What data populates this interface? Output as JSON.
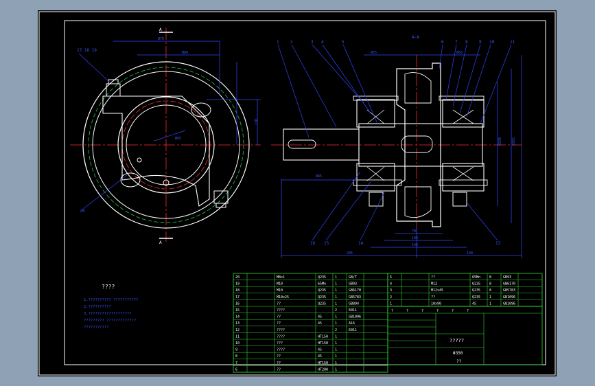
{
  "colors": {
    "outer": "#8fa2b5",
    "paper": "#000000",
    "border": "#ffffff",
    "outline": "#ffffff",
    "centerline": "#ff2a2a",
    "dimension": "#3344ff",
    "hidden": "#22cc44",
    "table": "#33dd33",
    "note_text": "#3355ff",
    "label": "#ffffff"
  },
  "section_mark": "A-A",
  "section_top_label": "A",
  "section_bottom_label": "A",
  "left_leader_labels": "17 18 19",
  "left_bottom_label": "20",
  "dims_left": {
    "top": "Ø70",
    "top2": "Ø84",
    "center": "Ø85",
    "right": "130",
    "far_right": "Ø90"
  },
  "dims_right": {
    "d1": "Ø45",
    "d2": "Ø55",
    "d3": "Ø60",
    "bottom1": "70",
    "bottom2": "100",
    "bottom3": "140",
    "bottom4": "170",
    "total_left": "205",
    "total_right": "190",
    "bore": "Ø280",
    "outer": "Ø355"
  },
  "balloons_top": [
    "1",
    "2",
    "3",
    "4",
    "5",
    "6",
    "7",
    "8",
    "9",
    "10",
    "11",
    "12"
  ],
  "balloons_bottom": [
    "16",
    "15",
    "14",
    "13"
  ],
  "notes": {
    "title": "????",
    "lines": [
      "1.??????????  ???????????",
      "2.??????????",
      "3.???????????????????",
      "  ????????? ?????????????",
      "  ???????????"
    ]
  },
  "parts_left": [
    {
      "no": "20",
      "code": "",
      "name": "M8x1",
      "qty": "1",
      "mat": "Q235",
      "spec": "GB/T"
    },
    {
      "no": "19",
      "code": "",
      "name": "M10",
      "qty": "1",
      "mat": "65Mn",
      "spec": "GB93"
    },
    {
      "no": "18",
      "code": "",
      "name": "M10",
      "qty": "1",
      "mat": "Q235",
      "spec": "GB6170"
    },
    {
      "no": "17",
      "code": "",
      "name": "M10x25",
      "qty": "1",
      "mat": "Q235",
      "spec": "GB5783"
    },
    {
      "no": "16",
      "code": "",
      "name": "??",
      "qty": "1",
      "mat": "Q235",
      "spec": "GB894"
    },
    {
      "no": "15",
      "code": "",
      "name": "????",
      "qty": "2",
      "mat": "",
      "spec": "6011"
    },
    {
      "no": "14",
      "code": "",
      "name": "??",
      "qty": "1",
      "mat": "45",
      "spec": "GB1096"
    },
    {
      "no": "13",
      "code": "",
      "name": "??",
      "qty": "1",
      "mat": "45",
      "spec": "A16"
    },
    {
      "no": "12",
      "code": "",
      "name": "????",
      "qty": "2",
      "mat": "",
      "spec": "6011"
    },
    {
      "no": "11",
      "code": "",
      "name": "????",
      "qty": "1",
      "mat": "HT150",
      "spec": ""
    },
    {
      "no": "10",
      "code": "",
      "name": "???",
      "qty": "1",
      "mat": "HT150",
      "spec": ""
    },
    {
      "no": "9",
      "code": "",
      "name": "????",
      "qty": "1",
      "mat": "45",
      "spec": ""
    },
    {
      "no": "8",
      "code": "",
      "name": "??",
      "qty": "1",
      "mat": "45",
      "spec": ""
    },
    {
      "no": "7",
      "code": "",
      "name": "??",
      "qty": "1",
      "mat": "HT150",
      "spec": ""
    },
    {
      "no": "6",
      "code": "",
      "name": "??",
      "qty": "1",
      "mat": "HT200",
      "spec": ""
    }
  ],
  "parts_right": [
    {
      "no": "5",
      "name": "??",
      "qty": "8",
      "mat": "65Mn",
      "spec": "GB93"
    },
    {
      "no": "4",
      "name": "M12",
      "qty": "8",
      "mat": "Q235",
      "spec": "GB6170"
    },
    {
      "no": "3",
      "name": "M12x45",
      "qty": "8",
      "mat": "Q235",
      "spec": "GB5783"
    },
    {
      "no": "2",
      "name": "??",
      "qty": "1",
      "mat": "Q235",
      "spec": "GB1096"
    },
    {
      "no": "1",
      "name": "10x90",
      "qty": "1",
      "mat": "45",
      "spec": "GB1096"
    }
  ],
  "title_block": {
    "drawing_name": "?????",
    "drawing_code": "Φ350",
    "scale_label": "??",
    "header": [
      "?",
      "?",
      "?",
      "?",
      "?",
      "?"
    ]
  }
}
